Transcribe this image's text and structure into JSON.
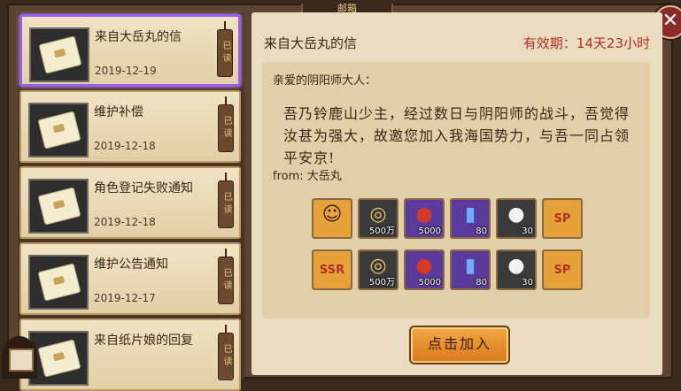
{
  "header": {
    "title": "邮箱"
  },
  "mail_list": [
    {
      "title": "来自大岳丸的信",
      "date": "2019-12-19",
      "status": "已读",
      "selected": true
    },
    {
      "title": "维护补偿",
      "date": "2019-12-18",
      "status": "已读",
      "selected": false
    },
    {
      "title": "角色登记失败通知",
      "date": "2019-12-18",
      "status": "已读",
      "selected": false
    },
    {
      "title": "维护公告通知",
      "date": "2019-12-17",
      "status": "已读",
      "selected": false
    },
    {
      "title": "来自纸片娘的回复",
      "date": "",
      "status": "已读",
      "selected": false
    }
  ],
  "detail": {
    "title": "来自大岳丸的信",
    "validity_label": "有效期：",
    "validity_value": "14天23小时",
    "greeting": "亲爱的阴阳师大人：",
    "body": "吾乃铃鹿山少主，经过数日与阴阳师的战斗，吾觉得汝甚为强大，故邀您加入我海国势力，与吾一同占领平安京!",
    "from_label": "from:",
    "from_name": "大岳丸",
    "rewards": [
      [
        {
          "icon": "shikigami-portrait-icon",
          "count": "",
          "bg": "#e6a13a",
          "glyph": "☺"
        },
        {
          "icon": "gold-coin-icon",
          "count": "500万",
          "bg": "#3a3a3a",
          "glyph": "◎"
        },
        {
          "icon": "red-daruma-icon",
          "count": "5000",
          "bg": "#5a3a9a",
          "glyph": "●"
        },
        {
          "icon": "blue-ticket-icon",
          "count": "80",
          "bg": "#5a3a9a",
          "glyph": "▮"
        },
        {
          "icon": "black-daruma-icon",
          "count": "30",
          "bg": "#3a3a3a",
          "glyph": "●"
        },
        {
          "icon": "sp-shikigami-icon",
          "count": "",
          "bg": "#e6a13a",
          "glyph": "SP"
        }
      ],
      [
        {
          "icon": "ssr-shikigami-icon",
          "count": "",
          "bg": "#e6a13a",
          "glyph": "SSR"
        },
        {
          "icon": "gold-coin-icon",
          "count": "500万",
          "bg": "#3a3a3a",
          "glyph": "◎"
        },
        {
          "icon": "red-daruma-icon",
          "count": "5000",
          "bg": "#5a3a9a",
          "glyph": "●"
        },
        {
          "icon": "blue-ticket-icon",
          "count": "80",
          "bg": "#5a3a9a",
          "glyph": "▮"
        },
        {
          "icon": "black-daruma-icon",
          "count": "30",
          "bg": "#3a3a3a",
          "glyph": "●"
        },
        {
          "icon": "sp-shikigami-icon",
          "count": "",
          "bg": "#e6a13a",
          "glyph": "SP"
        }
      ]
    ],
    "button_label": "点击加入"
  },
  "colors": {
    "selected_border": "#9b5cf0",
    "validity_red": "#b2301f",
    "button_orange": "#e8902c"
  }
}
